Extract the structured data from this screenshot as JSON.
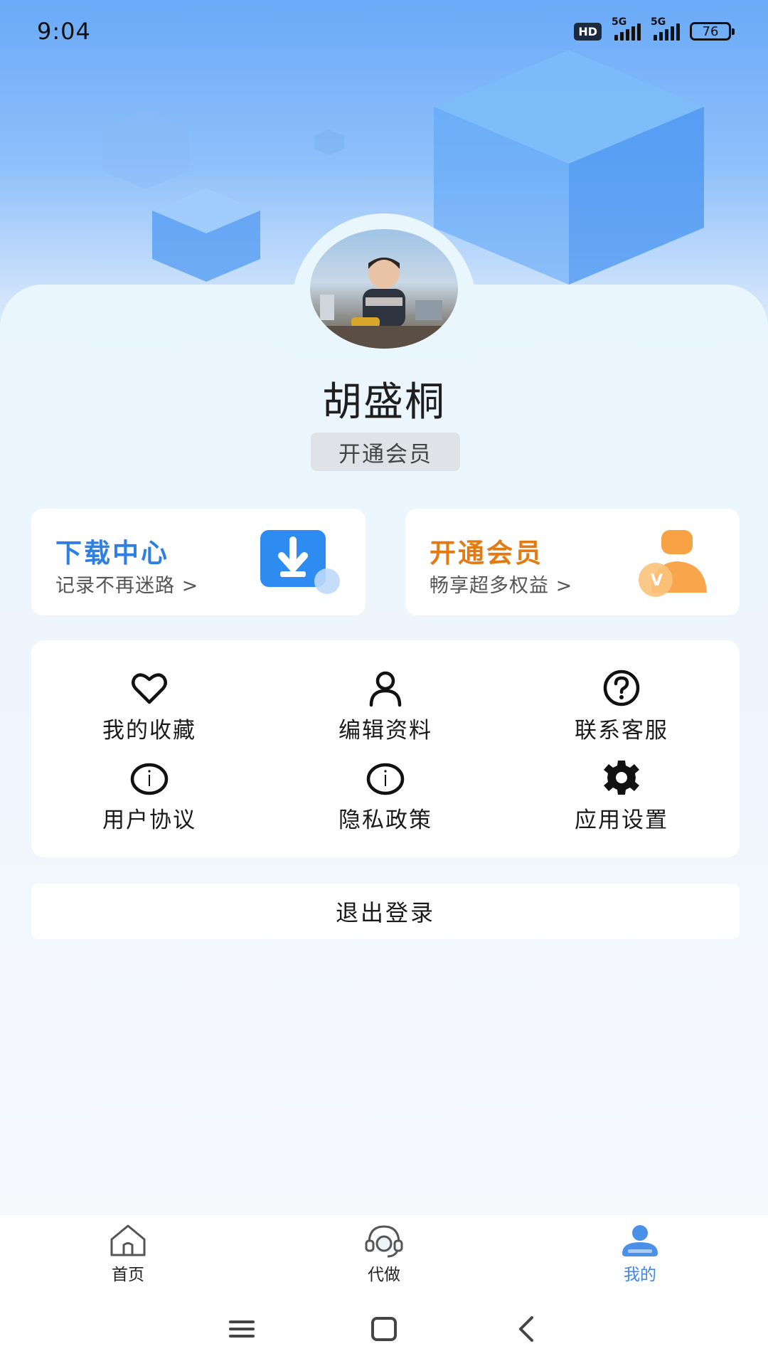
{
  "status_bar": {
    "time": "9:04",
    "hd": "HD",
    "network_1": "5G",
    "network_2": "5G",
    "battery": "76"
  },
  "profile": {
    "name": "胡盛桐",
    "vip_button": "开通会员"
  },
  "promo_cards": [
    {
      "title": "下载中心",
      "subtitle": "记录不再迷路 >",
      "accent": "#2f7fe3",
      "icon": "download-icon"
    },
    {
      "title": "开通会员",
      "subtitle": "畅享超多权益 >",
      "accent": "#e37b12",
      "icon": "vip-person-icon"
    }
  ],
  "menu": [
    {
      "label": "我的收藏",
      "icon": "heart-icon"
    },
    {
      "label": "编辑资料",
      "icon": "person-icon"
    },
    {
      "label": "联系客服",
      "icon": "help-circle-icon"
    },
    {
      "label": "用户协议",
      "icon": "info-icon"
    },
    {
      "label": "隐私政策",
      "icon": "info-icon"
    },
    {
      "label": "应用设置",
      "icon": "gear-icon"
    }
  ],
  "logout_label": "退出登录",
  "tabbar": [
    {
      "label": "首页",
      "icon": "home-icon",
      "active": false
    },
    {
      "label": "代做",
      "icon": "headset-icon",
      "active": false
    },
    {
      "label": "我的",
      "icon": "user-icon",
      "active": true
    }
  ],
  "colors": {
    "active_tab": "#3f86e6",
    "download_accent": "#2f7fe3",
    "vip_accent": "#e37b12"
  }
}
